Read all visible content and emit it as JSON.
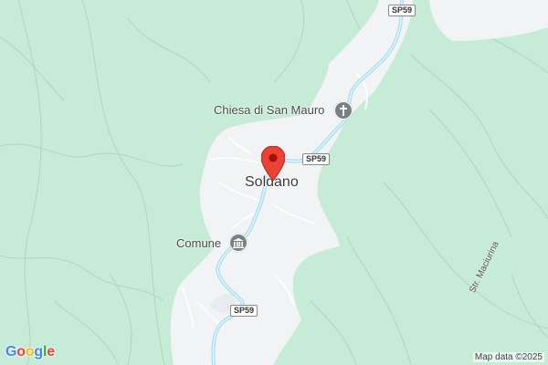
{
  "map": {
    "town_label": "Soldano",
    "road_shields": [
      "SP59",
      "SP59",
      "SP59"
    ],
    "poi": [
      {
        "name": "Chiesa di San Mauro",
        "icon": "cross-icon"
      },
      {
        "name": "Comune",
        "icon": "government-building-icon"
      }
    ],
    "street_label": "Str. Maciurina",
    "marker_icon": "location-pin-icon",
    "colors": {
      "forest": "#c6ecd7",
      "town_area": "#f1f3f4",
      "river": "#a8dff0",
      "terrain_lines": "#b5cbbf",
      "marker": "#ea4335"
    }
  },
  "footer": {
    "logo_letters": [
      "G",
      "o",
      "o",
      "g",
      "l",
      "e"
    ],
    "logo_colors": [
      "#4285f4",
      "#ea4335",
      "#fbbc05",
      "#4285f4",
      "#34a853",
      "#ea4335"
    ],
    "attribution": "Map data ©2025"
  }
}
